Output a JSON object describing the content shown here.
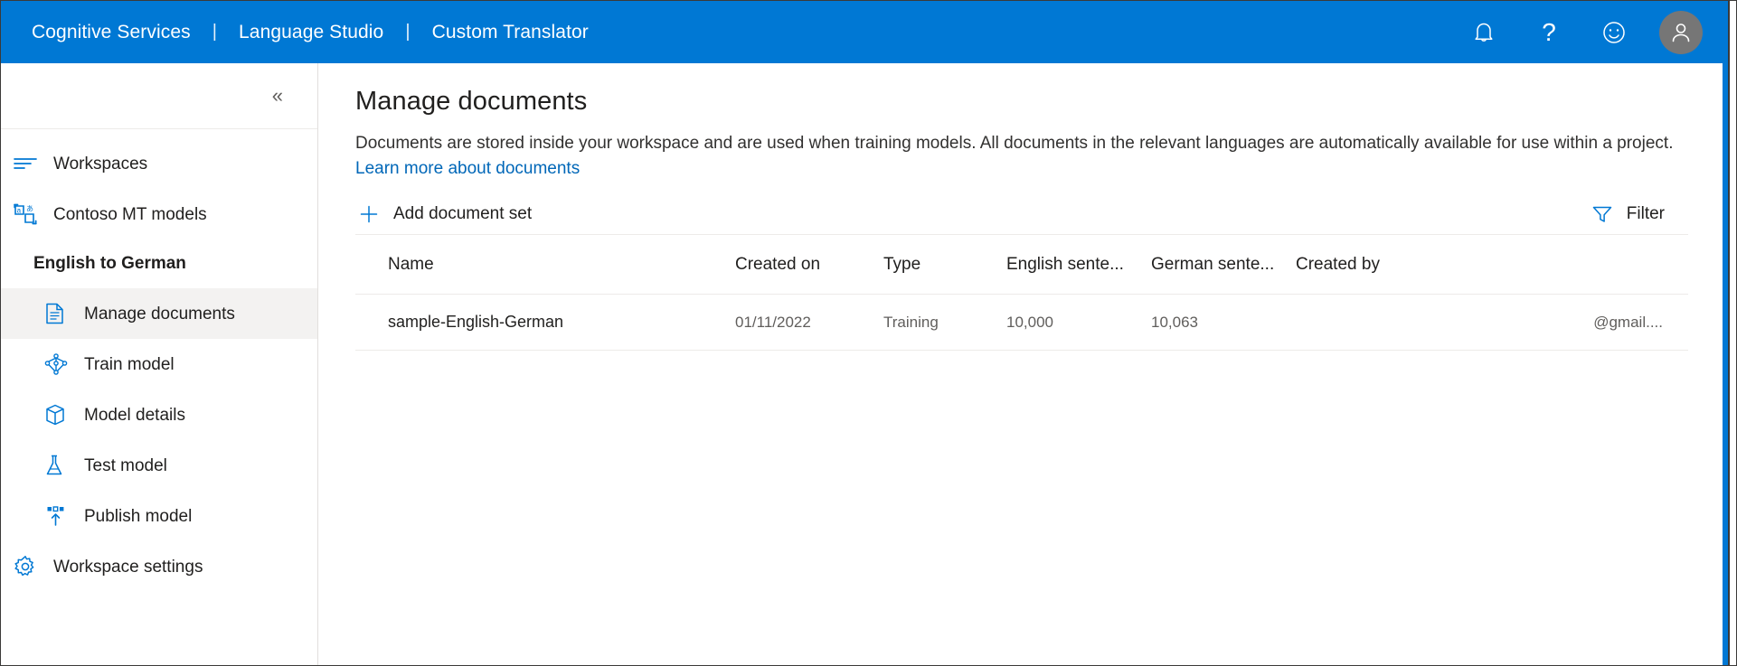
{
  "topbar": {
    "brand": [
      "Cognitive Services",
      "Language Studio",
      "Custom Translator"
    ],
    "separator": "|",
    "icons": {
      "notifications": "bell-icon",
      "help": "?",
      "feedback": "smiley-icon",
      "account": "person-avatar"
    },
    "background": "#0078d4"
  },
  "sidebar": {
    "collapse_label": "«",
    "items": [
      {
        "label": "Workspaces",
        "icon": "menu-lines-icon",
        "selected": false,
        "indent": false,
        "heading": false
      },
      {
        "label": "Contoso MT models",
        "icon": "translate-icon",
        "selected": false,
        "indent": false,
        "heading": false
      },
      {
        "label": "English to German",
        "icon": "",
        "selected": false,
        "indent": false,
        "heading": true
      },
      {
        "label": "Manage documents",
        "icon": "document-icon",
        "selected": true,
        "indent": true,
        "heading": false
      },
      {
        "label": "Train model",
        "icon": "neural-network-icon",
        "selected": false,
        "indent": true,
        "heading": false
      },
      {
        "label": "Model details",
        "icon": "box-icon",
        "selected": false,
        "indent": true,
        "heading": false
      },
      {
        "label": "Test model",
        "icon": "flask-icon",
        "selected": false,
        "indent": true,
        "heading": false
      },
      {
        "label": "Publish model",
        "icon": "publish-upload-icon",
        "selected": false,
        "indent": true,
        "heading": false
      },
      {
        "label": "Workspace settings",
        "icon": "gear-icon",
        "selected": false,
        "indent": false,
        "heading": false
      }
    ]
  },
  "main": {
    "title": "Manage documents",
    "description": "Documents are stored inside your workspace and are used when training models. All documents in the relevant languages are automatically available for use within a project. ",
    "link_label": "Learn more about documents",
    "toolbar": {
      "add_label": "Add document set",
      "add_icon": "plus-icon",
      "filter_label": "Filter",
      "filter_icon": "funnel-icon"
    },
    "table": {
      "columns": [
        "Name",
        "Created on",
        "Type",
        "English sente...",
        "German sente...",
        "Created by"
      ],
      "rows": [
        {
          "name": "sample-English-German",
          "created_on": "01/11/2022",
          "type": "Training",
          "english_sentences": "10,000",
          "german_sentences": "10,063",
          "created_by": "@gmail...."
        }
      ]
    }
  },
  "colors": {
    "accent": "#0078d4",
    "link": "#0067b8",
    "selected_bg": "#f3f2f1",
    "divider": "#edebe9",
    "text_primary": "#201f1e",
    "text_secondary": "#605e5c"
  }
}
